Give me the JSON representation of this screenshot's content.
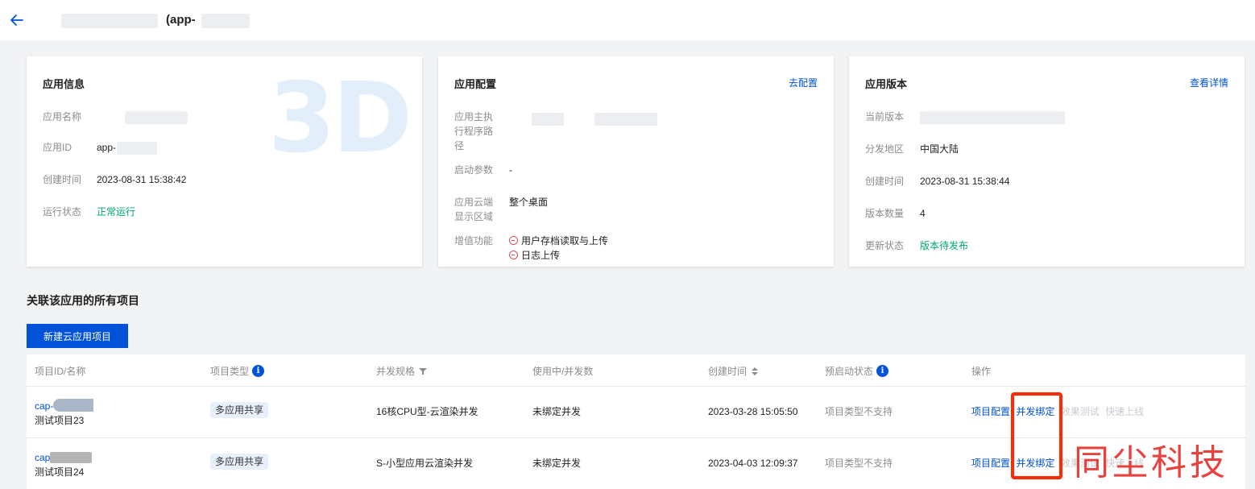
{
  "header": {
    "title_suffix": "(app-"
  },
  "app_info": {
    "title": "应用信息",
    "fields": {
      "name_label": "应用名称",
      "id_label": "应用ID",
      "id_value": "app-",
      "created_label": "创建时间",
      "created_value": "2023-08-31 15:38:42",
      "status_label": "运行状态",
      "status_value": "正常运行"
    },
    "watermark": "3D"
  },
  "app_config": {
    "title": "应用配置",
    "link": "去配置",
    "fields": {
      "exec_path_label": "应用主执行程序路径",
      "params_label": "启动参数",
      "params_value": "-",
      "display_label": "应用云端显示区域",
      "display_value": "整个桌面",
      "addons_label": "增值功能",
      "addon_1": "用户存档读取与上传",
      "addon_2": "日志上传"
    }
  },
  "app_version": {
    "title": "应用版本",
    "link": "查看详情",
    "fields": {
      "current_label": "当前版本",
      "region_label": "分发地区",
      "region_value": "中国大陆",
      "created_label": "创建时间",
      "created_value": "2023-08-31 15:38:44",
      "count_label": "版本数量",
      "count_value": "4",
      "update_label": "更新状态",
      "update_value": "版本待发布"
    }
  },
  "projects": {
    "section_title": "关联该应用的所有项目",
    "new_button": "新建云应用项目",
    "columns": {
      "id_name": "项目ID/名称",
      "type": "项目类型",
      "spec": "并发规格",
      "usage": "使用中/并发数",
      "created": "创建时间",
      "prestart": "预启动状态",
      "ops": "操作"
    },
    "rows": [
      {
        "id_prefix": "cap-",
        "name": "测试项目23",
        "type": "多应用共享",
        "spec": "16核CPU型-云渲染并发",
        "usage": "未绑定并发",
        "created": "2023-03-28 15:05:50",
        "prestart": "项目类型不支持",
        "op_config": "项目配置",
        "op_bind": "并发绑定",
        "op_test": "效果测试",
        "op_launch": "快速上线"
      },
      {
        "id_prefix": "cap",
        "name": "测试项目24",
        "type": "多应用共享",
        "spec": "S-小型应用云渲染并发",
        "usage": "未绑定并发",
        "created": "2023-04-03 12:09:37",
        "prestart": "项目类型不支持",
        "op_config": "项目配置",
        "op_bind": "并发绑定",
        "op_test": "效果测试",
        "op_launch": "快速上线"
      }
    ]
  },
  "overlay": {
    "watermark_text": "同尘科技"
  },
  "colors": {
    "primary": "#0052d9",
    "success": "#00a870",
    "error": "#e34d59",
    "highlight": "#ff2a00"
  }
}
